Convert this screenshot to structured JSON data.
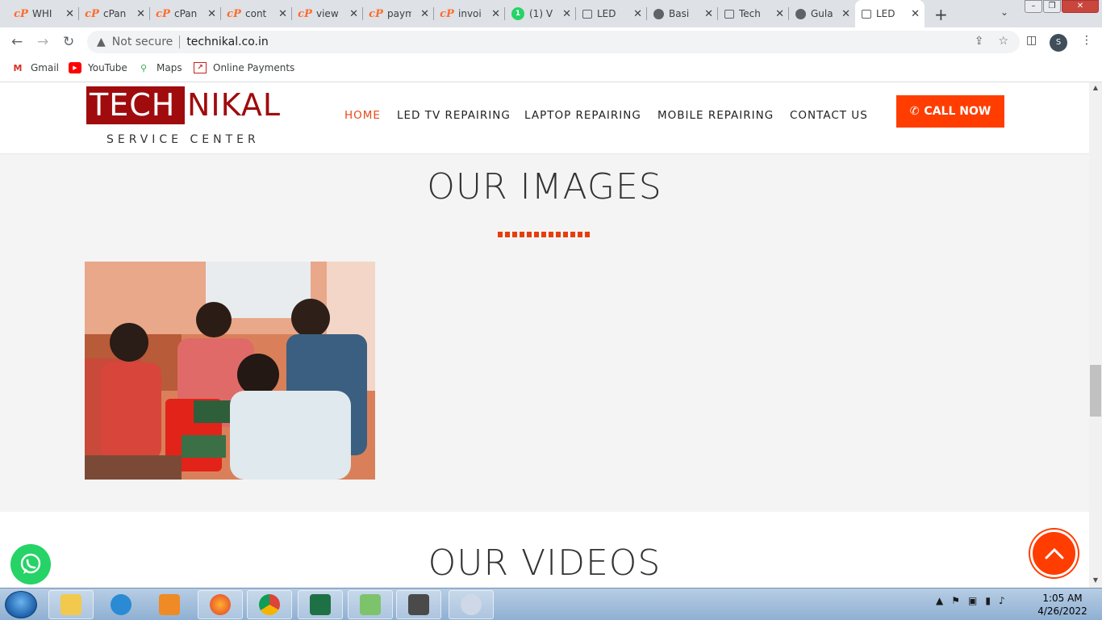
{
  "browser": {
    "tabs": [
      {
        "title": "WHI",
        "icon": "cpanel-icon"
      },
      {
        "title": "cPan",
        "icon": "cpanel-icon"
      },
      {
        "title": "cPan",
        "icon": "cpanel-icon"
      },
      {
        "title": "cont",
        "icon": "cpanel-icon"
      },
      {
        "title": "view",
        "icon": "cpanel-icon"
      },
      {
        "title": "paym",
        "icon": "cpanel-icon"
      },
      {
        "title": "invoi",
        "icon": "cpanel-icon"
      },
      {
        "title": "(1) V",
        "icon": "whatsapp-icon",
        "badge": "1"
      },
      {
        "title": "LED",
        "icon": "monitor-icon"
      },
      {
        "title": "Basi",
        "icon": "globe-icon"
      },
      {
        "title": "Tech",
        "icon": "monitor-icon"
      },
      {
        "title": "Gula",
        "icon": "globe-icon"
      },
      {
        "title": "LED",
        "icon": "monitor-icon",
        "active": true
      }
    ],
    "address": {
      "security": "Not secure",
      "url": "technikal.co.in"
    },
    "profile_initial": "S",
    "bookmarks": [
      {
        "label": "Gmail",
        "icon": "gmail-icon"
      },
      {
        "label": "YouTube",
        "icon": "youtube-icon"
      },
      {
        "label": "Maps",
        "icon": "maps-icon"
      },
      {
        "label": "Online Payments",
        "icon": "chart-icon"
      }
    ]
  },
  "site": {
    "logo": {
      "highlight": "TECH",
      "rest": "NIKAL",
      "sub": "SERVICE CENTER"
    },
    "nav": [
      {
        "label": "HOME",
        "active": true
      },
      {
        "label": "LED TV REPAIRING"
      },
      {
        "label": "LAPTOP REPAIRING"
      },
      {
        "label": "MOBILE REPAIRING"
      },
      {
        "label": "CONTACT US"
      }
    ],
    "call_now": "CALL NOW",
    "images_title": "OUR IMAGES",
    "videos_title": "OUR VIDEOS",
    "accent_color": "#ff3d00",
    "brand_color": "#a00b0d"
  },
  "taskbar": {
    "apps": [
      "explorer-icon",
      "ie-icon",
      "media-player-icon",
      "firefox-icon",
      "chrome-icon",
      "excel-icon",
      "notepad-icon",
      "sublime-icon",
      "paint-icon"
    ],
    "time": "1:05 AM",
    "date": "4/26/2022"
  }
}
